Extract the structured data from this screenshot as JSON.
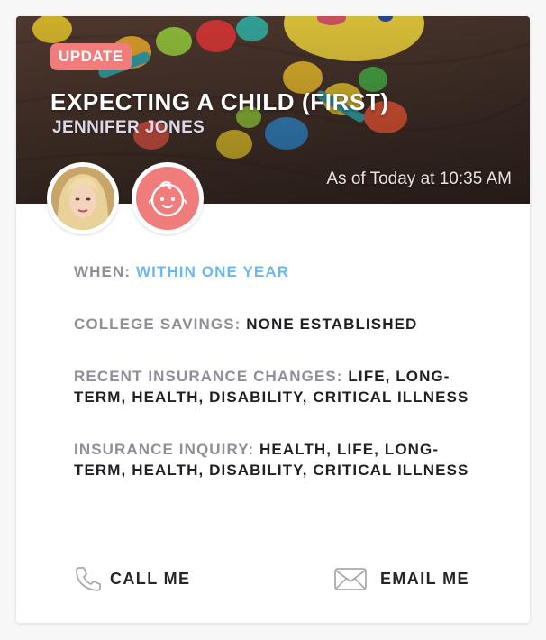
{
  "card": {
    "badge": "UPDATE",
    "title": "EXPECTING A CHILD (FIRST)",
    "subtitle": "JENNIFER JONES",
    "timestamp": "As of Today at 10:35 AM"
  },
  "details": {
    "when": {
      "label": "WHEN:",
      "value": "WITHIN ONE YEAR"
    },
    "college": {
      "label": "COLLEGE SAVINGS:",
      "value": "NONE ESTABLISHED"
    },
    "recent": {
      "label": "RECENT INSURANCE CHANGES:",
      "value": "LIFE, LONG-TERM, HEALTH, DISABILITY, CRITICAL ILLNESS"
    },
    "inquiry": {
      "label": "INSURANCE INQUIRY:",
      "value": "HEALTH, LIFE, LONG-TERM, HEALTH, DISABILITY, CRITICAL ILLNESS"
    }
  },
  "actions": {
    "call": "CALL ME",
    "email": "EMAIL ME"
  },
  "colors": {
    "accent_coral": "#f07c7c",
    "value_blue": "#6ab8f0",
    "label_gray": "#8e8f99",
    "text_dark": "#1f1f24"
  },
  "icons": {
    "call": "phone-icon",
    "email": "envelope-icon",
    "baby": "baby-face-icon"
  }
}
